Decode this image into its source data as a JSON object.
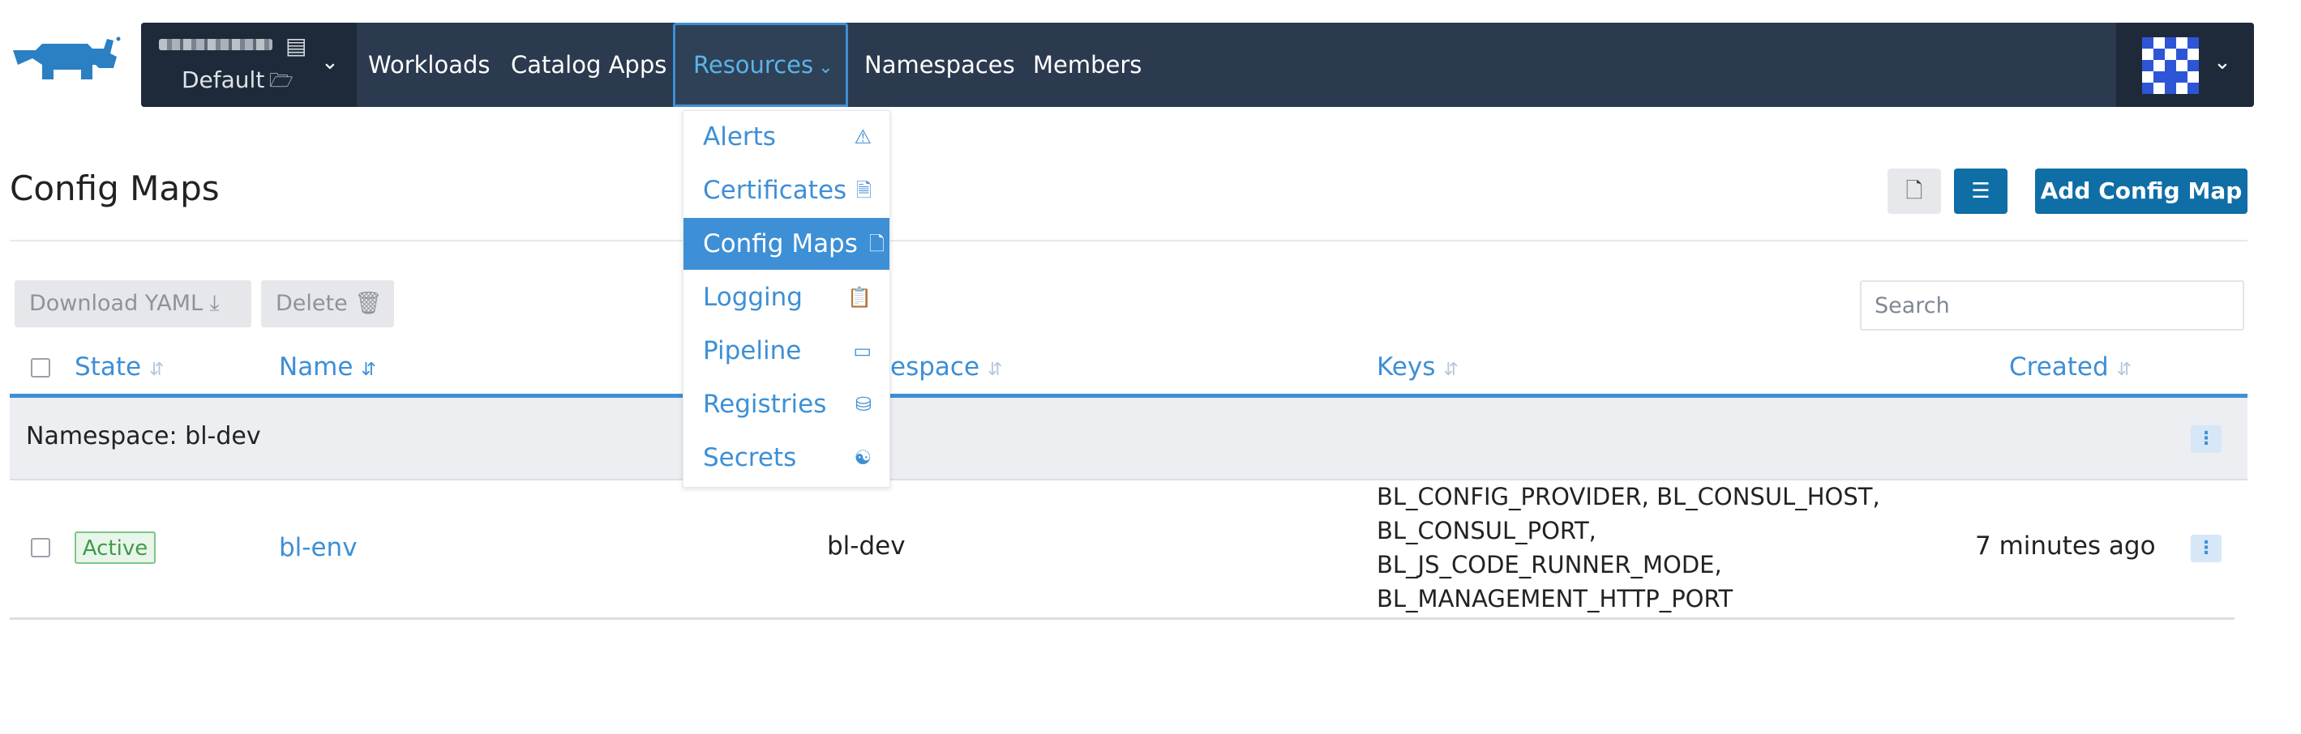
{
  "navbar": {
    "project_label": "Default",
    "items": [
      {
        "label": "Workloads"
      },
      {
        "label": "Catalog Apps"
      },
      {
        "label": "Resources"
      },
      {
        "label": "Namespaces"
      },
      {
        "label": "Members"
      }
    ],
    "active_item": "Resources"
  },
  "resources_menu": {
    "items": [
      {
        "label": "Alerts",
        "icon": "warning-icon"
      },
      {
        "label": "Certificates",
        "icon": "certificate-icon"
      },
      {
        "label": "Config Maps",
        "icon": "file-icon",
        "selected": true
      },
      {
        "label": "Logging",
        "icon": "clipboard-icon"
      },
      {
        "label": "Pipeline",
        "icon": "pipeline-icon"
      },
      {
        "label": "Registries",
        "icon": "database-icon"
      },
      {
        "label": "Secrets",
        "icon": "secret-icon"
      }
    ]
  },
  "page": {
    "title": "Config Maps",
    "add_button": "Add Config Map"
  },
  "bulk_actions": {
    "download": "Download YAML",
    "delete": "Delete"
  },
  "search": {
    "placeholder": "Search",
    "value": ""
  },
  "table": {
    "headers": {
      "state": "State",
      "name": "Name",
      "namespace": "espace",
      "keys": "Keys",
      "created": "Created"
    },
    "group_label": "Namespace: bl-dev",
    "rows": [
      {
        "state": "Active",
        "name": "bl-env",
        "namespace": "bl-dev",
        "keys": [
          "BL_CONFIG_PROVIDER, BL_CONSUL_HOST,",
          "BL_CONSUL_PORT,",
          "BL_JS_CODE_RUNNER_MODE,",
          "BL_MANAGEMENT_HTTP_PORT"
        ],
        "created": "7 minutes ago"
      }
    ]
  },
  "colors": {
    "navbar": "#2b3a4f",
    "accent": "#3d8fd6",
    "primary_button": "#0f6ea6",
    "active_badge": "#3f9a4b"
  }
}
